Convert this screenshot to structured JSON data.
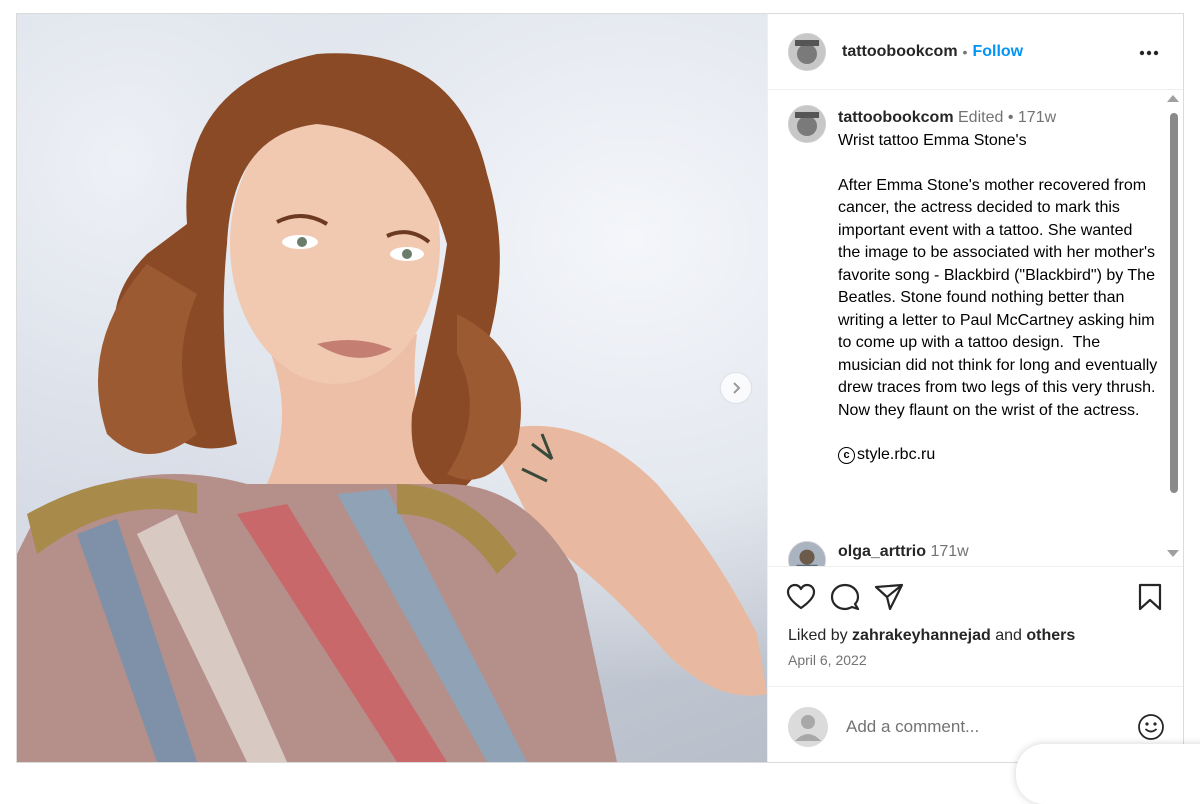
{
  "post": {
    "username": "tattoobookcom",
    "follow_label": "Follow",
    "separator": "•",
    "more_icon": "more-horizontal-icon",
    "avatar_text": "tattoobook"
  },
  "caption": {
    "username": "tattoobookcom",
    "edited_label": "Edited",
    "time": "171w",
    "text": "Wrist tattoo Emma Stone's\n\nAfter Emma Stone's mother recovered from cancer, the actress decided to mark this important event with a tattoo. She wanted the image to be associated with her mother's favorite song - Blackbird (\"Blackbird\") by The Beatles. Stone found nothing better than writing a letter to Paul McCartney asking him to come up with a tattoo design.  The musician did not think for long and eventually drew traces from two legs of this very thrush.  Now they flaunt on the wrist of the actress.",
    "credit_symbol": "c",
    "credit": "style.rbc.ru"
  },
  "comment": {
    "username": "olga_arttrio",
    "time": "171w"
  },
  "likes": {
    "prefix": "Liked by",
    "user": "zahrakeyhannejad",
    "conjunction": "and",
    "others": "others"
  },
  "date": "April 6, 2022",
  "add_comment": {
    "placeholder": "Add a comment..."
  },
  "icons": {
    "like": "heart-icon",
    "comment": "comment-icon",
    "share": "send-icon",
    "save": "bookmark-icon",
    "emoji": "emoji-icon",
    "next": "chevron-right-icon"
  },
  "colors": {
    "accent": "#0095f6",
    "muted": "#737373",
    "text": "#262626",
    "border": "#dbdbdb"
  }
}
